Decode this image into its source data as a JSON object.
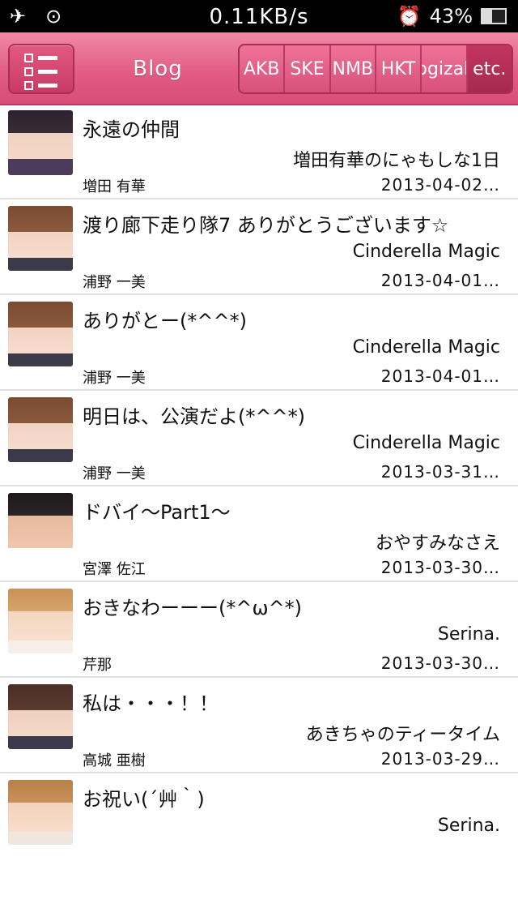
{
  "status": {
    "speed": "0.11KB/s",
    "battery": "43%",
    "battery_level": 0.43
  },
  "header": {
    "title": "Blog",
    "groups": [
      "AKB",
      "SKE",
      "NMB",
      "HKT",
      "Nogizaka",
      "etc."
    ]
  },
  "posts": [
    {
      "title": "永遠の仲間",
      "blog": "増田有華のにゃもしな1日",
      "author": "増田 有華",
      "date": "2013-04-02…"
    },
    {
      "title": "渡り廊下走り隊7 ありがとうございます☆",
      "blog": "Cinderella Magic",
      "author": "浦野 一美",
      "date": "2013-04-01…"
    },
    {
      "title": "ありがとー(*^^*)",
      "blog": "Cinderella Magic",
      "author": "浦野 一美",
      "date": "2013-04-01…"
    },
    {
      "title": "明日は、公演だよ(*^^*)",
      "blog": "Cinderella Magic",
      "author": "浦野 一美",
      "date": "2013-03-31…"
    },
    {
      "title": "ドバイ～Part1～",
      "blog": "おやすみなさえ",
      "author": "宮澤 佐江",
      "date": "2013-03-30…"
    },
    {
      "title": "おきなわーーー(*^ω^*)",
      "blog": "Serina.",
      "author": "芹那",
      "date": "2013-03-30…"
    },
    {
      "title": "私は・・・！！",
      "blog": "あきちゃのティータイム",
      "author": "高城 亜樹",
      "date": "2013-03-29…"
    },
    {
      "title": "お祝い(´艸｀)",
      "blog": "Serina.",
      "author": "",
      "date": ""
    }
  ]
}
